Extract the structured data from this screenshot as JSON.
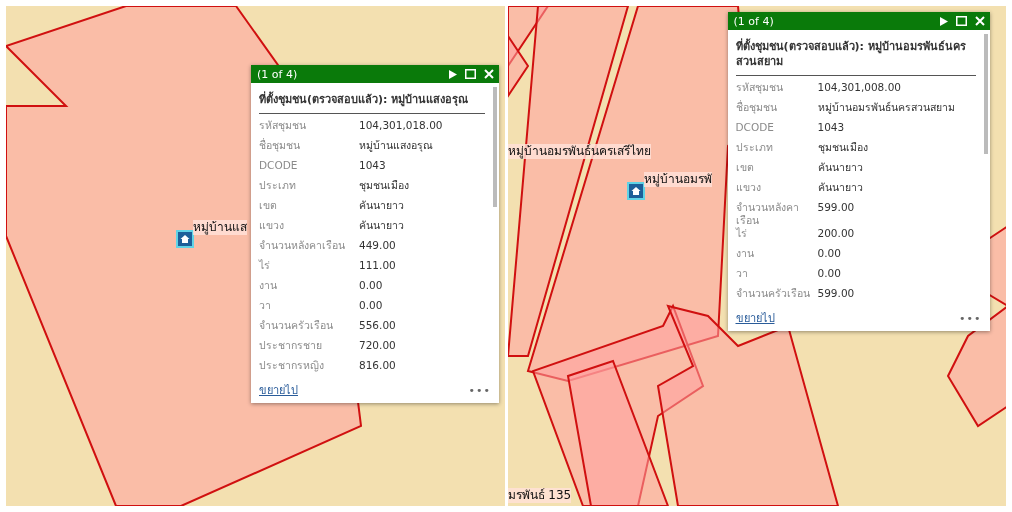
{
  "panels": [
    {
      "marker_label": "หมู่บ้านแส",
      "popup": {
        "counter": "(1 of 4)",
        "title": "ที่ตั้งชุมชน(ตรวจสอบแล้ว): หมู่บ้านแสงอรุณ",
        "fields": [
          {
            "label": "รหัสชุมชน",
            "value": "104,301,018.00"
          },
          {
            "label": "ชื่อชุมชน",
            "value": "หมู่บ้านแสงอรุณ"
          },
          {
            "label": "DCODE",
            "value": "1043"
          },
          {
            "label": "ประเภท",
            "value": "ชุมชนเมือง"
          },
          {
            "label": "เขต",
            "value": "คันนายาว"
          },
          {
            "label": "แขวง",
            "value": "คันนายาว"
          },
          {
            "label": "จำนวนหลังคาเรือน",
            "value": "449.00"
          },
          {
            "label": "ไร่",
            "value": "111.00"
          },
          {
            "label": "งาน",
            "value": "0.00"
          },
          {
            "label": "วา",
            "value": "0.00"
          },
          {
            "label": "จำนวนครัวเรือน",
            "value": "556.00"
          },
          {
            "label": "ประชากรชาย",
            "value": "720.00"
          },
          {
            "label": "ประชากรหญิง",
            "value": "816.00"
          }
        ],
        "link": "ขยายไป",
        "menu": "•••"
      }
    },
    {
      "marker_label": "หมู่บ้านอมรพั",
      "map_labels": [
        "หมู่บ้านอมรพันธ์นครเสรีไทย",
        "มรพันธ์ 135"
      ],
      "popup": {
        "counter": "(1 of 4)",
        "title": "ที่ตั้งชุมชน(ตรวจสอบแล้ว): หมู่บ้านอมรพันธ์นครสวนสยาม",
        "fields": [
          {
            "label": "รหัสชุมชน",
            "value": "104,301,008.00"
          },
          {
            "label": "ชื่อชุมชน",
            "value": "หมู่บ้านอมรพันธ์นครสวนสยาม"
          },
          {
            "label": "DCODE",
            "value": "1043"
          },
          {
            "label": "ประเภท",
            "value": "ชุมชนเมือง"
          },
          {
            "label": "เขต",
            "value": "คันนายาว"
          },
          {
            "label": "แขวง",
            "value": "คันนายาว"
          },
          {
            "label": "จำนวนหลังคาเรือน",
            "value": "599.00"
          },
          {
            "label": "ไร่",
            "value": "200.00"
          },
          {
            "label": "งาน",
            "value": "0.00"
          },
          {
            "label": "วา",
            "value": "0.00"
          },
          {
            "label": "จำนวนครัวเรือน",
            "value": "599.00"
          }
        ],
        "link": "ขยายไป",
        "menu": "•••"
      }
    }
  ]
}
